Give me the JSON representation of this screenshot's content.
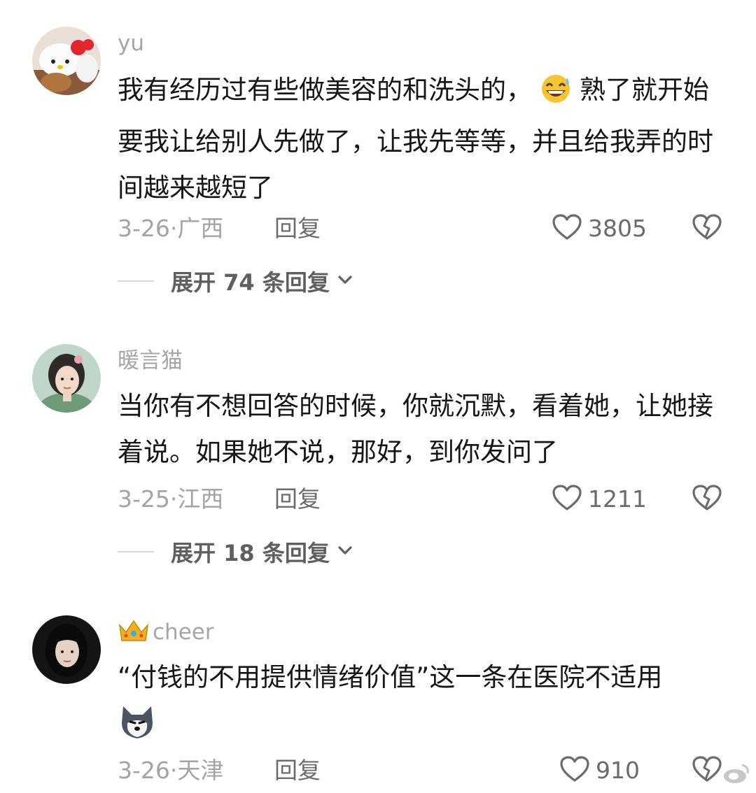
{
  "comments": [
    {
      "username": "yu",
      "text_a": "我有经历过有些做美容的和洗头的，",
      "text_b": "熟了就开始要我让给别人先做了，让我先等等，并且给我弄的时间越来越短了",
      "emoji": "grinning-sweat-emoji",
      "date": "3-26",
      "location": "广西",
      "reply_label": "回复",
      "likes": "3805",
      "expand_label": "展开 74 条回复"
    },
    {
      "username": "暖言猫",
      "text": "当你有不想回答的时候，你就沉默，看着她，让她接着说。如果她不说，那好，到你发问了",
      "date": "3-25",
      "location": "江西",
      "reply_label": "回复",
      "likes": "1211",
      "expand_label": "展开 18 条回复"
    },
    {
      "username": "cheer",
      "badge": "crown-icon",
      "text": "“付钱的不用提供情绪价值”这一条在医院不适用",
      "emoji": "husky-dog-emoji",
      "date": "3-26",
      "location": "天津",
      "reply_label": "回复",
      "likes": "910"
    }
  ],
  "colors": {
    "username": "#a6a6a6",
    "meta": "#a4a4a4",
    "action": "#6b6b6b",
    "text": "#161616"
  }
}
